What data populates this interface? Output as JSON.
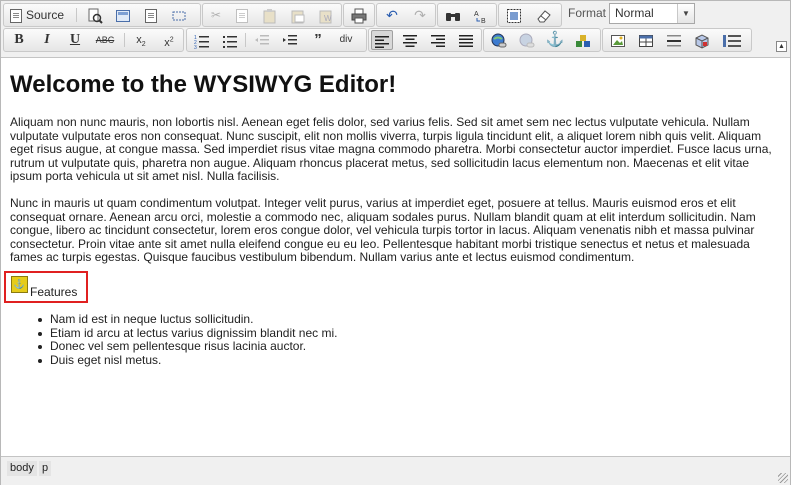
{
  "toolbar": {
    "source_label": "Source",
    "format_label": "Format",
    "format_value": "Normal",
    "icons": [
      "source-icon",
      "preview-icon",
      "templates-icon",
      "new-page-icon",
      "show-blocks-icon",
      "cut-icon",
      "copy-icon",
      "paste-icon",
      "paste-text-icon",
      "paste-word-icon",
      "print-icon",
      "undo-icon",
      "redo-icon",
      "find-icon",
      "replace-icon",
      "select-all-icon",
      "remove-format-icon",
      "bold-icon",
      "italic-icon",
      "underline-icon",
      "strikethrough-icon",
      "subscript-icon",
      "superscript-icon",
      "numbered-list-icon",
      "bulleted-list-icon",
      "outdent-icon",
      "indent-icon",
      "blockquote-icon",
      "create-div-icon",
      "align-left-icon",
      "align-center-icon",
      "align-right-icon",
      "justify-icon",
      "link-icon",
      "unlink-icon",
      "anchor-icon",
      "flash-icon",
      "image-icon",
      "table-icon",
      "horizontal-rule-icon",
      "smiley-icon",
      "special-char-icon"
    ]
  },
  "content": {
    "heading": "Welcome to the WYSIWYG Editor!",
    "para1": "Aliquam non nunc mauris, non lobortis nisl. Aenean eget felis dolor, sed varius felis. Sed sit amet sem nec lectus vulputate vehicula. Nullam vulputate vulputate eros non consequat. Nunc suscipit, elit non mollis viverra, turpis ligula tincidunt elit, a aliquet lorem nibh quis velit. Aliquam eget risus augue, at congue massa. Sed imperdiet risus vitae magna commodo pharetra. Morbi consectetur auctor imperdiet. Fusce lacus urna, rutrum ut vulputate quis, pharetra non augue. Aliquam rhoncus placerat metus, sed sollicitudin lacus elementum non. Maecenas et elit vitae ipsum porta vehicula ut sit amet nisl. Nulla facilisis.",
    "para2": "Nunc in mauris ut quam condimentum volutpat. Integer velit purus, varius at imperdiet eget, posuere at tellus. Mauris euismod eros et elit consequat ornare. Aenean arcu orci, molestie a commodo nec, aliquam sodales purus. Nullam blandit quam at elit interdum sollicitudin. Nam congue, libero ac tincidunt consectetur, lorem eros congue dolor, vel vehicula turpis tortor in lacus. Aliquam venenatis nibh et massa pulvinar consectetur. Proin vitae ante sit amet nulla eleifend congue eu eu leo. Pellentesque habitant morbi tristique senectus et netus et malesuada fames ac turpis egestas. Quisque faucibus vestibulum bibendum. Nullam varius ante et lectus euismod condimentum.",
    "features_label": "Features",
    "bullets": [
      "Nam id est in neque luctus sollicitudin.",
      "Etiam id arcu at lectus varius dignissim blandit nec mi.",
      "Donec vel sem pellentesque risus lacinia auctor.",
      "Duis eget nisl metus."
    ]
  },
  "statusbar": {
    "crumbs": [
      "body",
      "p"
    ]
  },
  "colors": {
    "toolbar_bg": "#f0f0f0",
    "selection_outline": "#e02020",
    "anchor_icon": "#e6cc1a"
  }
}
